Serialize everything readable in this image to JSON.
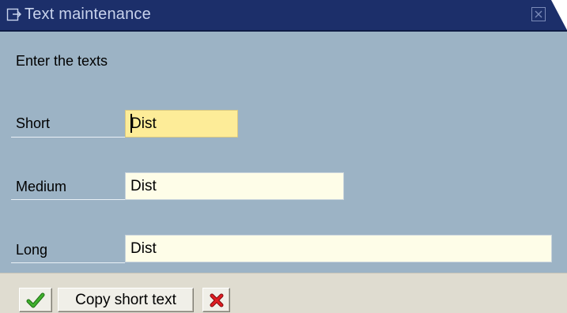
{
  "window": {
    "title": "Text maintenance"
  },
  "form": {
    "prompt": "Enter the texts",
    "fields": [
      {
        "label": "Short",
        "value": "Dist"
      },
      {
        "label": "Medium",
        "value": "Dist"
      },
      {
        "label": "Long",
        "value": "Dist"
      }
    ]
  },
  "toolbar": {
    "confirm_icon": "green-checkmark-icon",
    "copy_label": "Copy short text",
    "cancel_icon": "red-x-icon"
  },
  "colors": {
    "title_bar": "#1c2f6a",
    "dialog_background": "#9cb3c5",
    "focused_field": "#fdec98",
    "field": "#fefde8",
    "toolbar": "#dfdcd0",
    "confirm": "#2f9a22",
    "cancel": "#d4161b"
  }
}
